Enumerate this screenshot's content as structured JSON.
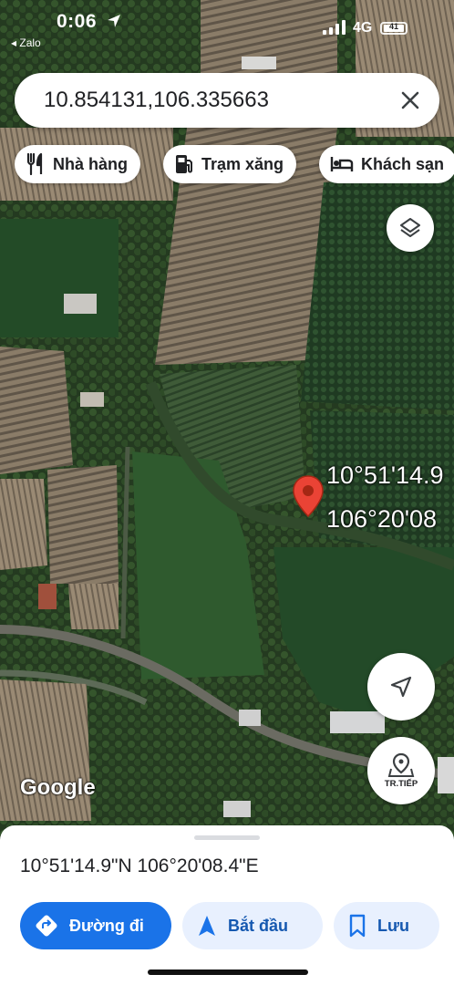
{
  "status_bar": {
    "time": "0:06",
    "back_app": "◂ Zalo",
    "network": "4G",
    "battery": "41"
  },
  "search": {
    "value": "10.854131,106.335663"
  },
  "chips": [
    {
      "label": "Nhà hàng",
      "icon": "fork-knife-icon"
    },
    {
      "label": "Trạm xăng",
      "icon": "gas-station-icon"
    },
    {
      "label": "Khách sạn",
      "icon": "bed-icon"
    }
  ],
  "map": {
    "pin_label_lat": "10°51'14.9",
    "pin_label_lng": "106°20'08",
    "attribution": "Google",
    "nav_caption": "TR.TIẾP",
    "layers_icon": "layers-icon",
    "locate_icon": "navigation-arrow-icon"
  },
  "sheet": {
    "coordinates": "10°51'14.9\"N 106°20'08.4\"E",
    "actions": [
      {
        "label": "Đường đi",
        "icon": "directions-icon"
      },
      {
        "label": "Bắt đầu",
        "icon": "start-arrow-icon"
      },
      {
        "label": "Lưu",
        "icon": "bookmark-icon"
      }
    ]
  },
  "colors": {
    "accent": "#1a73e8",
    "pin": "#ea4335",
    "chip_bg": "#ffffff"
  }
}
